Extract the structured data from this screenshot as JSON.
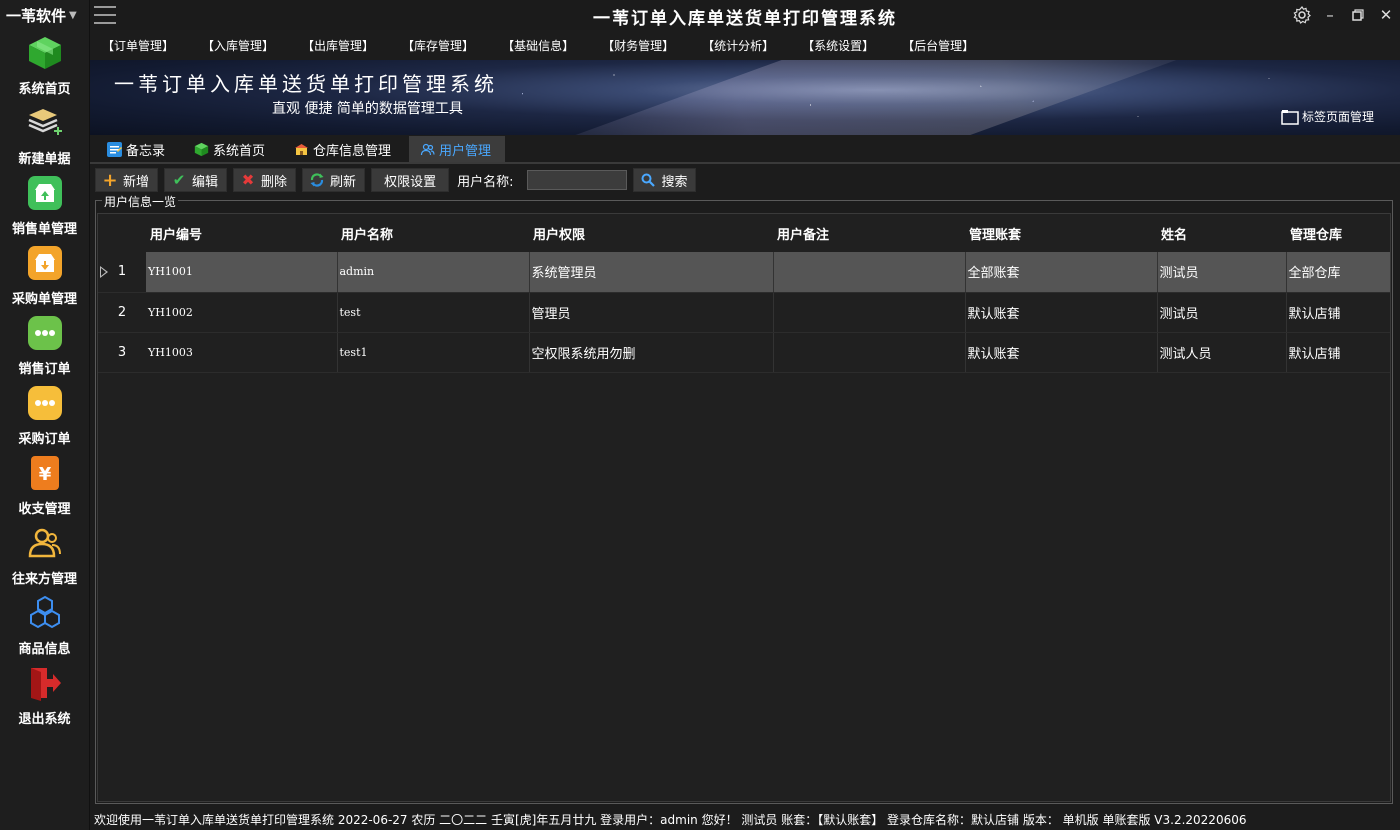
{
  "brand": {
    "name": "一苇软件"
  },
  "sidebar": {
    "items": [
      {
        "label": "系统首页",
        "icon": "green-cube-icon"
      },
      {
        "label": "新建单据",
        "icon": "layers-add-icon"
      },
      {
        "label": "销售单管理",
        "icon": "upload-box-icon"
      },
      {
        "label": "采购单管理",
        "icon": "download-box-icon"
      },
      {
        "label": "销售订单",
        "icon": "green-dots-icon"
      },
      {
        "label": "采购订单",
        "icon": "yellow-dots-icon"
      },
      {
        "label": "收支管理",
        "icon": "yen-icon"
      },
      {
        "label": "往来方管理",
        "icon": "users-icon"
      },
      {
        "label": "商品信息",
        "icon": "cubes-icon"
      },
      {
        "label": "退出系统",
        "icon": "exit-icon"
      }
    ]
  },
  "titlebar": {
    "title": "一苇订单入库单送货单打印管理系统"
  },
  "menu": {
    "items": [
      "【订单管理】",
      "【入库管理】",
      "【出库管理】",
      "【库存管理】",
      "【基础信息】",
      "【财务管理】",
      "【统计分析】",
      "【系统设置】",
      "【后台管理】"
    ]
  },
  "banner": {
    "title": "一苇订单入库单送货单打印管理系统",
    "subtitle": "直观 便捷 简单的数据管理工具",
    "tab_manager": "标签页面管理"
  },
  "tabs": [
    {
      "label": "备忘录",
      "icon": "memo-icon"
    },
    {
      "label": "系统首页",
      "icon": "green-cube-icon"
    },
    {
      "label": "仓库信息管理",
      "icon": "warehouse-icon"
    },
    {
      "label": "用户管理",
      "icon": "users-icon",
      "active": true
    }
  ],
  "toolbar": {
    "add": "新增",
    "edit": "编辑",
    "delete": "删除",
    "refresh": "刷新",
    "permissions": "权限设置",
    "username_label": "用户名称:",
    "search_value": "",
    "search": "搜索"
  },
  "group": {
    "label": "用户信息一览"
  },
  "table": {
    "columns": [
      "用户编号",
      "用户名称",
      "用户权限",
      "用户备注",
      "管理账套",
      "姓名",
      "管理仓库"
    ],
    "rows": [
      {
        "idx": "1",
        "code": "YH1001",
        "name": "admin",
        "role": "系统管理员",
        "note": "",
        "account": "全部账套",
        "person": "测试员",
        "warehouse": "全部仓库"
      },
      {
        "idx": "2",
        "code": "YH1002",
        "name": "test",
        "role": "管理员",
        "note": "",
        "account": "默认账套",
        "person": "测试员",
        "warehouse": "默认店铺"
      },
      {
        "idx": "3",
        "code": "YH1003",
        "name": "test1",
        "role": "空权限系统用勿删",
        "note": "",
        "account": "默认账套",
        "person": "测试人员",
        "warehouse": "默认店铺"
      }
    ],
    "selected_row": 1
  },
  "status": {
    "text": "欢迎使用一苇订单入库单送货单打印管理系统 2022-06-27 农历 二〇二二 壬寅[虎]年五月廿九 登录用户：admin 您好！ 测试员 账套：【默认账套】 登录仓库名称：默认店铺 版本：  单机版 单账套版 V3.2.20220606"
  },
  "colors": {
    "background": "#1c1c1c",
    "active_tab_text": "#4aa8ff",
    "selected_row": "#555555"
  }
}
